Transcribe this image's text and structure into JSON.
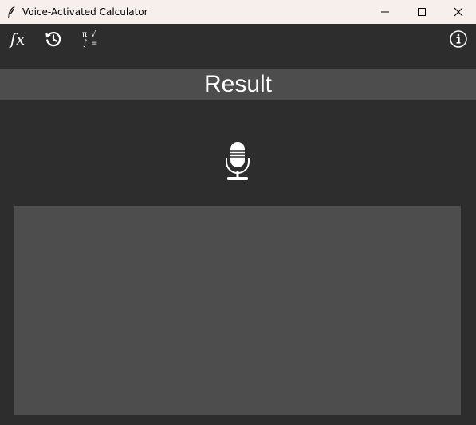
{
  "window": {
    "title": "Voice-Activated Calculator",
    "app_icon": "feather-icon",
    "controls": {
      "minimize": "minimize-icon",
      "maximize": "maximize-icon",
      "close": "close-icon"
    }
  },
  "toolbar": {
    "functions_label": "fx",
    "history_icon": "history-icon",
    "symbols_icon": "math-symbols-icon",
    "symbols_glyphs": {
      "pi": "π",
      "sqrt": "√",
      "integral": "∫",
      "equals": "="
    },
    "info_icon": "info-icon"
  },
  "result": {
    "label": "Result"
  },
  "microphone": {
    "icon": "microphone-icon"
  },
  "output": {
    "value": ""
  },
  "colors": {
    "titlebar_bg": "#f7efeb",
    "window_bg": "#2d2d2d",
    "panel_bg": "#4d4d4d",
    "foreground": "#ffffff"
  }
}
